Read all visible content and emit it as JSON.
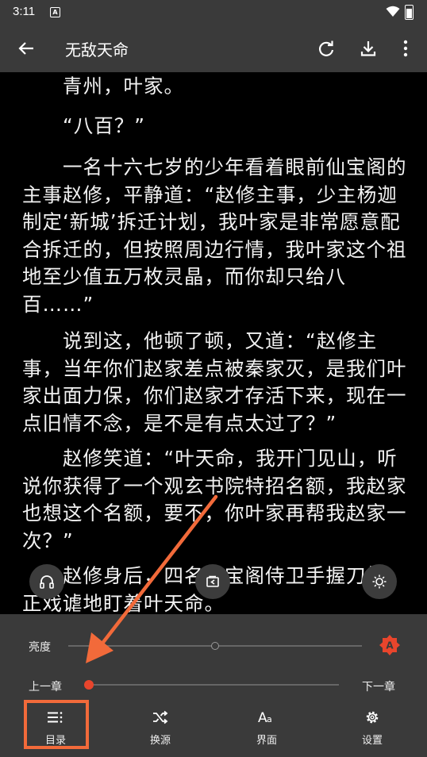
{
  "status_bar": {
    "time": "3:11",
    "notif_letter": "A"
  },
  "app_bar": {
    "title": "无敌天命"
  },
  "content": {
    "paragraphs": [
      "　　青州，叶家。",
      "　　“八百？”",
      "　　一名十六七岁的少年看着眼前仙宝阁的主事赵修，平静道：“赵修主事，少主杨迦制定‘新城’拆迁计划，我叶家是非常愿意配合拆迁的，但按照周边行情，我叶家这个祖地至少值五万枚灵晶，而你却只给八百……”",
      "　　说到这，他顿了顿，又道：“赵修主事，当年你们赵家差点被秦家灭，是我们叶家出面力保，你们赵家才存活下来，现在一点旧情不念，是不是有点太过了？”",
      "　　赵修笑道：“叶天命，我开门见山，听说你获得了一个观玄书院特招名额，我赵家也想这个名额，要不，你叶家再帮我赵家一次？”",
      "　　赵修身后，四名仙宝阁侍卫手握刀柄，正戏谑地盯着叶天命。"
    ]
  },
  "panel": {
    "brightness_label": "亮度",
    "brightness_level": 0.5,
    "auto_brightness_letter": "A",
    "prev_chapter": "上一章",
    "next_chapter": "下一章",
    "chapter_progress": 0.0
  },
  "bottom_nav": [
    {
      "label": "目录",
      "icon": "toc-icon"
    },
    {
      "label": "换源",
      "icon": "shuffle-icon"
    },
    {
      "label": "界面",
      "icon": "font-aa-icon"
    },
    {
      "label": "设置",
      "icon": "gear-icon"
    }
  ],
  "colors": {
    "accent": "#e8452c",
    "annotation": "#f26a3a",
    "bar": "#3a3a3a",
    "background": "#000000"
  }
}
